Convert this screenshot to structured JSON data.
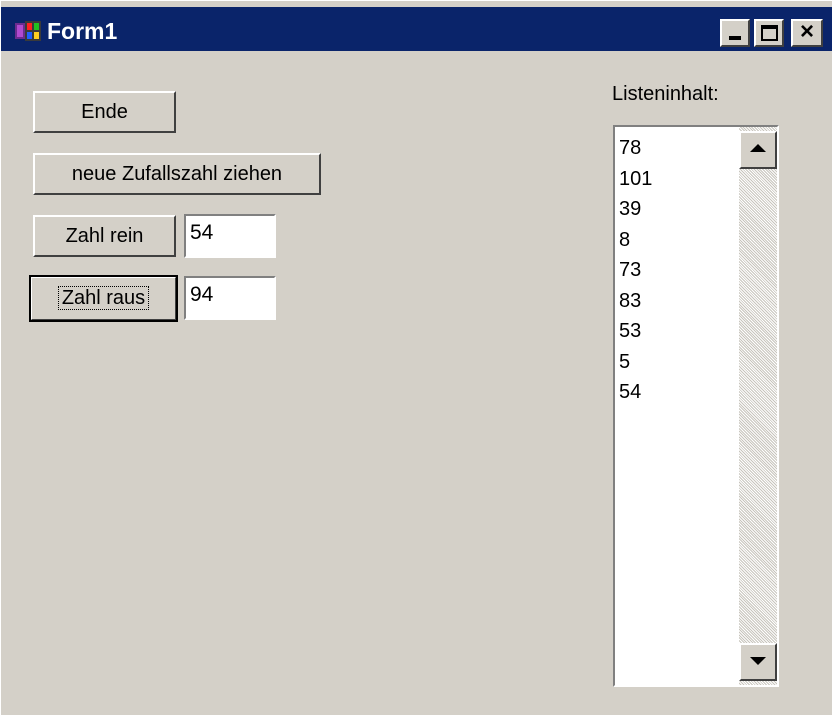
{
  "window": {
    "title": "Form1",
    "icon": "delphi-app-icon",
    "controls": {
      "minimize_icon": "minimize-icon",
      "maximize_icon": "maximize-icon",
      "close_icon": "close-icon",
      "close_glyph": "×"
    }
  },
  "buttons": {
    "ende": "Ende",
    "neue_zufallszahl": "neue Zufallszahl ziehen",
    "zahl_rein": "Zahl rein",
    "zahl_raus": "Zahl raus"
  },
  "inputs": {
    "zahl_rein_value": "54",
    "zahl_raus_value": "94"
  },
  "list": {
    "label": "Listeninhalt:",
    "items": [
      "78",
      "101",
      "39",
      "8",
      "73",
      "83",
      "53",
      "5",
      "54"
    ]
  },
  "colors": {
    "titlebar": "#0a246a",
    "face": "#d4d0c8"
  }
}
